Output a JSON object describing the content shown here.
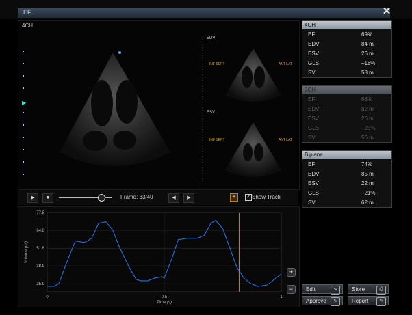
{
  "window": {
    "title": "EF",
    "close_icon": "close-icon"
  },
  "image": {
    "view_label": "4CH",
    "edv_label": "EDV",
    "esv_label": "ESV",
    "orient_left_1": "INF SEPT",
    "orient_right_1": "ANT LAT",
    "orient_left_2": "INF SEPT",
    "orient_right_2": "ANT LAT"
  },
  "playback": {
    "play_icon": "play-icon",
    "stop_icon": "stop-icon",
    "frame_text": "Frame: 33/40",
    "progress": 0.825,
    "prev_icon": "prev-frame-icon",
    "next_icon": "next-frame-icon",
    "show_track_label": "Show Track",
    "show_track_checked": true
  },
  "panels": [
    {
      "title": "4CH",
      "dim": false,
      "rows": [
        {
          "k": "EF",
          "v": "69%"
        },
        {
          "k": "EDV",
          "v": "84 ml"
        },
        {
          "k": "ESV",
          "v": "26 ml"
        },
        {
          "k": "GLS",
          "v": "–18%"
        },
        {
          "k": "SV",
          "v": "58 ml"
        }
      ]
    },
    {
      "title": "2CH",
      "dim": true,
      "rows": [
        {
          "k": "EF",
          "v": "68%"
        },
        {
          "k": "EDV",
          "v": "82 ml"
        },
        {
          "k": "ESV",
          "v": "26 ml"
        },
        {
          "k": "GLS",
          "v": "–25%"
        },
        {
          "k": "SV",
          "v": "56 ml"
        }
      ]
    },
    {
      "title": "Biplane",
      "dim": false,
      "rows": [
        {
          "k": "EF",
          "v": "74%"
        },
        {
          "k": "EDV",
          "v": "85 ml"
        },
        {
          "k": "ESV",
          "v": "22 ml"
        },
        {
          "k": "GLS",
          "v": "–21%"
        },
        {
          "k": "SV",
          "v": "62 ml"
        }
      ]
    }
  ],
  "actions": {
    "edit": "Edit",
    "store": "Store",
    "approve": "Approve",
    "report": "Report"
  },
  "zoom": {
    "plus": "+",
    "minus": "−"
  },
  "chart_data": {
    "type": "line",
    "xlabel": "Time (s)",
    "ylabel": "Volume (ml)",
    "xlim": [
      0,
      1
    ],
    "ylim": [
      20,
      77.8
    ],
    "yticks": [
      25.9,
      38.9,
      51.8,
      64.8,
      77.8
    ],
    "xticks": [
      0,
      0.5,
      1
    ],
    "cursor_x": 0.82,
    "grid": true,
    "series": [
      {
        "x": [
          0,
          0.03,
          0.05,
          0.08,
          0.12,
          0.16,
          0.19,
          0.22,
          0.25,
          0.28,
          0.31,
          0.35,
          0.38,
          0.4,
          0.43,
          0.46,
          0.49,
          0.5,
          0.53,
          0.56,
          0.6,
          0.64,
          0.67,
          0.7,
          0.72,
          0.75,
          0.78,
          0.81,
          0.84,
          0.87,
          0.9,
          0.94,
          0.97,
          1.0
        ],
        "y": [
          24,
          24,
          26,
          40,
          57,
          56,
          59,
          70,
          71,
          65,
          52,
          38,
          29,
          28,
          28,
          30,
          31,
          30,
          43,
          58,
          59,
          59,
          61,
          70,
          72,
          66,
          52,
          38,
          30,
          26,
          24,
          25,
          29,
          33
        ]
      }
    ]
  }
}
